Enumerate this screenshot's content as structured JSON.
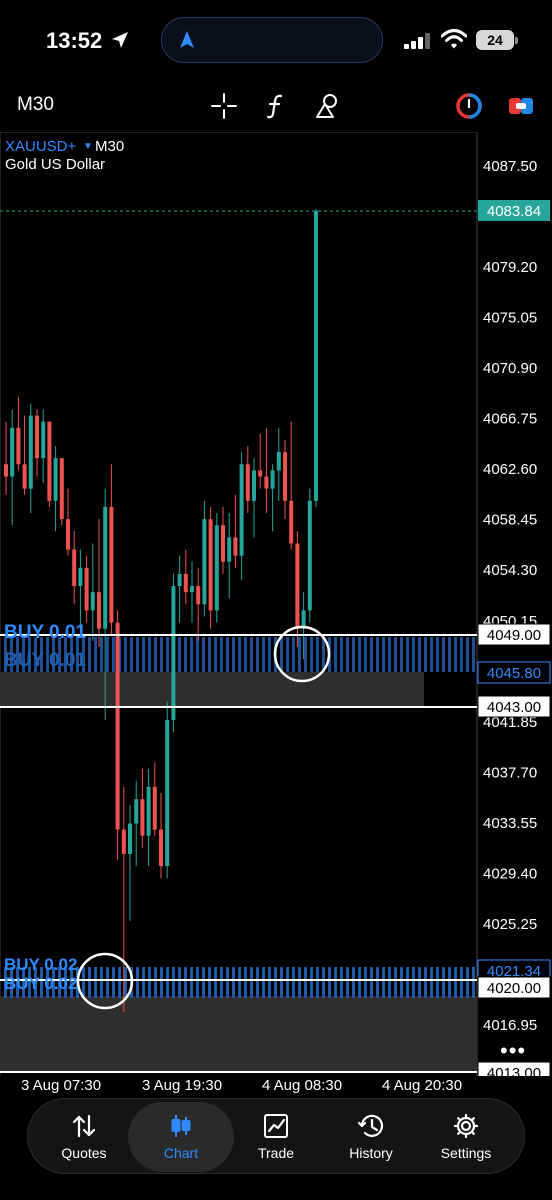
{
  "status_bar": {
    "time": "13:52",
    "battery": "24"
  },
  "toolbar": {
    "timeframe": "M30"
  },
  "chart": {
    "symbol": "XAUUSD+",
    "timeframe": "M30",
    "description": "Gold US Dollar",
    "price_labels": [
      "4087.50",
      "4079.20",
      "4075.05",
      "4070.90",
      "4066.75",
      "4062.60",
      "4058.45",
      "4054.30",
      "4050.15",
      "4041.85",
      "4037.70",
      "4033.55",
      "4029.40",
      "4025.25",
      "4016.95"
    ],
    "current_price": "4083.84",
    "order_lines": [
      {
        "label": "BUY 0.01",
        "price_label": "4049.00",
        "second_label": "4045.80",
        "lower_label": "4043.00"
      },
      {
        "label": "BUY 0.02",
        "price_label": "4021.34",
        "second_label": "4020.00",
        "lower_label": "4013.00"
      }
    ],
    "time_labels": [
      "3 Aug 07:30",
      "3 Aug 19:30",
      "4 Aug 08:30",
      "4 Aug 20:30"
    ],
    "colors": {
      "bull": "#26a69a",
      "bear": "#ef5350",
      "order": "#2e8bff",
      "current": "#26a69a"
    }
  },
  "chart_data": {
    "type": "candlestick",
    "symbol": "XAUUSD+",
    "title": "Gold US Dollar",
    "timeframe": "M30",
    "x_ticks": [
      "3 Aug 07:30",
      "3 Aug 19:30",
      "4 Aug 08:30",
      "4 Aug 20:30"
    ],
    "ylim": [
      4013.0,
      4091.0
    ],
    "y_ticks": [
      4087.5,
      4079.2,
      4075.05,
      4070.9,
      4066.75,
      4062.6,
      4058.45,
      4054.3,
      4050.15,
      4041.85,
      4037.7,
      4033.55,
      4029.4,
      4025.25,
      4016.95
    ],
    "current_price": 4083.84,
    "levels": [
      4049.0,
      4045.8,
      4043.0,
      4021.34,
      4020.0,
      4013.0
    ],
    "candles": [
      {
        "o": 4063.0,
        "h": 4066.5,
        "l": 4060.5,
        "c": 4062.0
      },
      {
        "o": 4062.0,
        "h": 4067.5,
        "l": 4058.0,
        "c": 4066.0
      },
      {
        "o": 4066.0,
        "h": 4068.5,
        "l": 4062.5,
        "c": 4063.0
      },
      {
        "o": 4063.0,
        "h": 4067.0,
        "l": 4060.5,
        "c": 4061.0
      },
      {
        "o": 4061.0,
        "h": 4068.0,
        "l": 4059.0,
        "c": 4067.0
      },
      {
        "o": 4067.0,
        "h": 4067.5,
        "l": 4062.0,
        "c": 4063.5
      },
      {
        "o": 4063.5,
        "h": 4067.5,
        "l": 4061.5,
        "c": 4066.5
      },
      {
        "o": 4066.5,
        "h": 4066.5,
        "l": 4059.5,
        "c": 4060.0
      },
      {
        "o": 4060.0,
        "h": 4064.5,
        "l": 4057.5,
        "c": 4063.5
      },
      {
        "o": 4063.5,
        "h": 4063.5,
        "l": 4058.0,
        "c": 4058.5
      },
      {
        "o": 4058.5,
        "h": 4061.0,
        "l": 4055.5,
        "c": 4056.0
      },
      {
        "o": 4056.0,
        "h": 4057.5,
        "l": 4051.5,
        "c": 4053.0
      },
      {
        "o": 4053.0,
        "h": 4056.0,
        "l": 4049.5,
        "c": 4054.5
      },
      {
        "o": 4054.5,
        "h": 4055.5,
        "l": 4050.0,
        "c": 4051.0
      },
      {
        "o": 4051.0,
        "h": 4056.5,
        "l": 4048.5,
        "c": 4052.5
      },
      {
        "o": 4052.5,
        "h": 4058.5,
        "l": 4048.0,
        "c": 4049.5
      },
      {
        "o": 4049.5,
        "h": 4061.0,
        "l": 4042.0,
        "c": 4059.5
      },
      {
        "o": 4059.5,
        "h": 4063.0,
        "l": 4049.0,
        "c": 4050.0
      },
      {
        "o": 4050.0,
        "h": 4051.0,
        "l": 4030.5,
        "c": 4033.0
      },
      {
        "o": 4033.0,
        "h": 4036.5,
        "l": 4018.0,
        "c": 4031.0
      },
      {
        "o": 4031.0,
        "h": 4035.0,
        "l": 4025.5,
        "c": 4033.5
      },
      {
        "o": 4033.5,
        "h": 4037.0,
        "l": 4030.0,
        "c": 4035.5
      },
      {
        "o": 4035.5,
        "h": 4038.0,
        "l": 4031.5,
        "c": 4032.5
      },
      {
        "o": 4032.5,
        "h": 4038.0,
        "l": 4030.0,
        "c": 4036.5
      },
      {
        "o": 4036.5,
        "h": 4038.5,
        "l": 4032.5,
        "c": 4033.0
      },
      {
        "o": 4033.0,
        "h": 4036.0,
        "l": 4029.0,
        "c": 4030.0
      },
      {
        "o": 4030.0,
        "h": 4043.5,
        "l": 4029.0,
        "c": 4042.0
      },
      {
        "o": 4042.0,
        "h": 4054.0,
        "l": 4041.0,
        "c": 4053.0
      },
      {
        "o": 4053.0,
        "h": 4055.5,
        "l": 4050.0,
        "c": 4054.0
      },
      {
        "o": 4054.0,
        "h": 4056.0,
        "l": 4051.5,
        "c": 4052.5
      },
      {
        "o": 4052.5,
        "h": 4055.0,
        "l": 4050.0,
        "c": 4053.0
      },
      {
        "o": 4053.0,
        "h": 4054.5,
        "l": 4048.5,
        "c": 4051.5
      },
      {
        "o": 4051.5,
        "h": 4060.0,
        "l": 4050.5,
        "c": 4058.5
      },
      {
        "o": 4058.5,
        "h": 4059.5,
        "l": 4049.5,
        "c": 4051.0
      },
      {
        "o": 4051.0,
        "h": 4059.0,
        "l": 4050.0,
        "c": 4058.0
      },
      {
        "o": 4058.0,
        "h": 4059.5,
        "l": 4054.0,
        "c": 4055.0
      },
      {
        "o": 4055.0,
        "h": 4059.0,
        "l": 4052.0,
        "c": 4057.0
      },
      {
        "o": 4057.0,
        "h": 4060.5,
        "l": 4054.5,
        "c": 4055.5
      },
      {
        "o": 4055.5,
        "h": 4064.0,
        "l": 4053.5,
        "c": 4063.0
      },
      {
        "o": 4063.0,
        "h": 4064.5,
        "l": 4059.0,
        "c": 4060.0
      },
      {
        "o": 4060.0,
        "h": 4063.5,
        "l": 4057.0,
        "c": 4062.5
      },
      {
        "o": 4062.5,
        "h": 4065.5,
        "l": 4061.0,
        "c": 4062.0
      },
      {
        "o": 4062.0,
        "h": 4066.0,
        "l": 4059.0,
        "c": 4061.0
      },
      {
        "o": 4061.0,
        "h": 4063.0,
        "l": 4057.5,
        "c": 4062.5
      },
      {
        "o": 4062.5,
        "h": 4066.0,
        "l": 4060.0,
        "c": 4064.0
      },
      {
        "o": 4064.0,
        "h": 4065.0,
        "l": 4058.5,
        "c": 4060.0
      },
      {
        "o": 4060.0,
        "h": 4066.5,
        "l": 4056.0,
        "c": 4056.5
      },
      {
        "o": 4056.5,
        "h": 4057.5,
        "l": 4048.0,
        "c": 4049.5
      },
      {
        "o": 4049.5,
        "h": 4052.5,
        "l": 4047.0,
        "c": 4051.0
      },
      {
        "o": 4051.0,
        "h": 4061.0,
        "l": 4050.0,
        "c": 4060.0
      },
      {
        "o": 4060.0,
        "h": 4084.0,
        "l": 4059.5,
        "c": 4083.8
      }
    ]
  },
  "tabs": [
    {
      "label": "Quotes",
      "icon": "up-down-arrows-icon"
    },
    {
      "label": "Chart",
      "icon": "candlestick-icon",
      "active": true
    },
    {
      "label": "Trade",
      "icon": "line-chart-icon"
    },
    {
      "label": "History",
      "icon": "history-clock-icon"
    },
    {
      "label": "Settings",
      "icon": "gear-icon"
    }
  ]
}
